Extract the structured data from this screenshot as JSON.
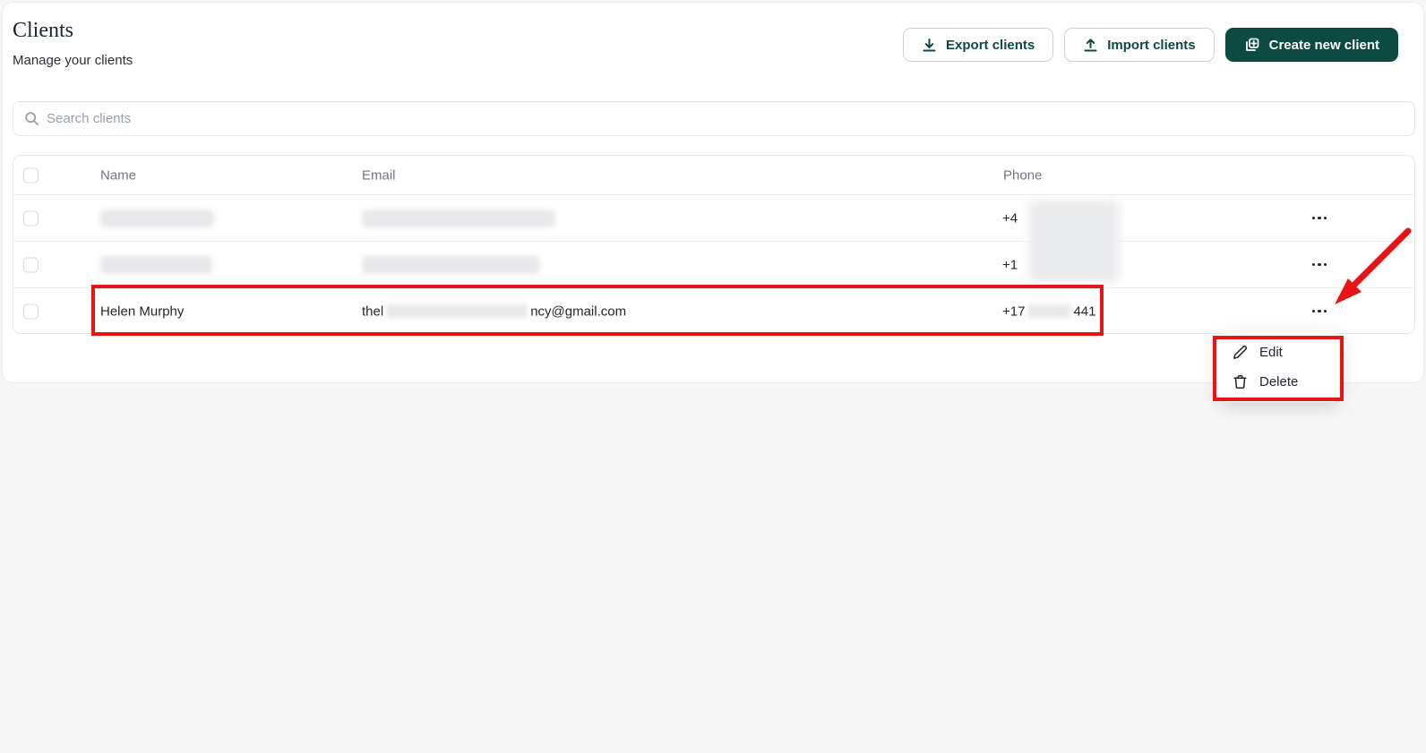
{
  "header": {
    "title": "Clients",
    "subtitle": "Manage your clients",
    "export_button": "Export clients",
    "import_button": "Import clients",
    "create_button": "Create new client"
  },
  "search": {
    "placeholder": "Search clients"
  },
  "table": {
    "columns": {
      "name": "Name",
      "email": "Email",
      "phone": "Phone"
    },
    "rows": [
      {
        "name": "",
        "email": "",
        "phone_prefix": "+4",
        "phone_suffix": "",
        "redacted": "full"
      },
      {
        "name": "",
        "email": "",
        "phone_prefix": "+1",
        "phone_suffix": "",
        "redacted": "full"
      },
      {
        "name": "Helen Murphy",
        "email_prefix": "thel",
        "email_suffix": "ncy@gmail.com",
        "phone_prefix": "+17",
        "phone_suffix": "441",
        "redacted": "partial"
      }
    ]
  },
  "context_menu": {
    "edit_label": "Edit",
    "delete_label": "Delete"
  },
  "colors": {
    "accent_green": "#0d4a42",
    "annotation_red": "#e81414"
  }
}
